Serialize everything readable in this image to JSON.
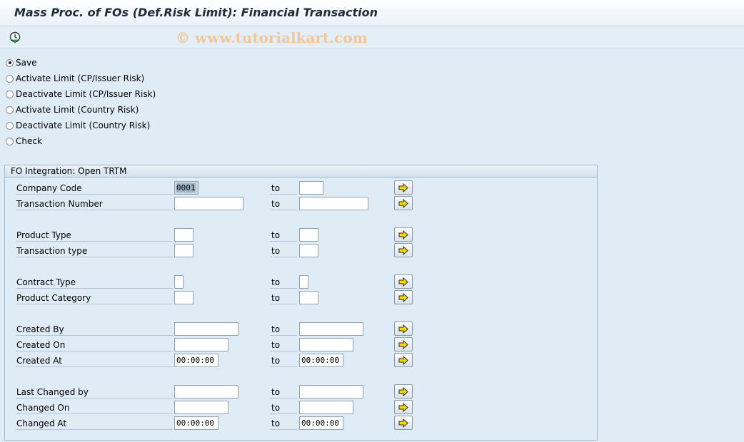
{
  "title": "Mass Proc. of FOs (Def.Risk Limit): Financial Transaction",
  "watermark": "© www.tutorialkart.com",
  "toolbar": {
    "execute_icon": "execute-clock-icon"
  },
  "radio_options": [
    {
      "label": "Save",
      "checked": true
    },
    {
      "label": "Activate Limit (CP/Issuer Risk)",
      "checked": false
    },
    {
      "label": "Deactivate Limit (CP/Issuer Risk)",
      "checked": false
    },
    {
      "label": "Activate Limit (Country Risk)",
      "checked": false
    },
    {
      "label": "Deactivate Limit (Country Risk)",
      "checked": false
    },
    {
      "label": "Check",
      "checked": false
    }
  ],
  "group": {
    "title": "FO Integration: Open TRTM",
    "to_label": "to",
    "rows": [
      {
        "label": "Company Code",
        "from": "0001",
        "to": ""
      },
      {
        "label": "Transaction Number",
        "from": "",
        "to": ""
      },
      {
        "label": "Product Type",
        "from": "",
        "to": ""
      },
      {
        "label": "Transaction type",
        "from": "",
        "to": ""
      },
      {
        "label": "Contract Type",
        "from": "",
        "to": ""
      },
      {
        "label": "Product Category",
        "from": "",
        "to": ""
      },
      {
        "label": "Created By",
        "from": "",
        "to": ""
      },
      {
        "label": "Created On",
        "from": "",
        "to": ""
      },
      {
        "label": "Created At",
        "from": "00:00:00",
        "to": "00:00:00"
      },
      {
        "label": "Last Changed by",
        "from": "",
        "to": ""
      },
      {
        "label": "Changed On",
        "from": "",
        "to": ""
      },
      {
        "label": "Changed At",
        "from": "00:00:00",
        "to": "00:00:00"
      }
    ]
  },
  "multiple_selection_icon": "arrow-right-icon",
  "colors": {
    "background": "#dfebf5",
    "arrow": "#f5d800"
  }
}
